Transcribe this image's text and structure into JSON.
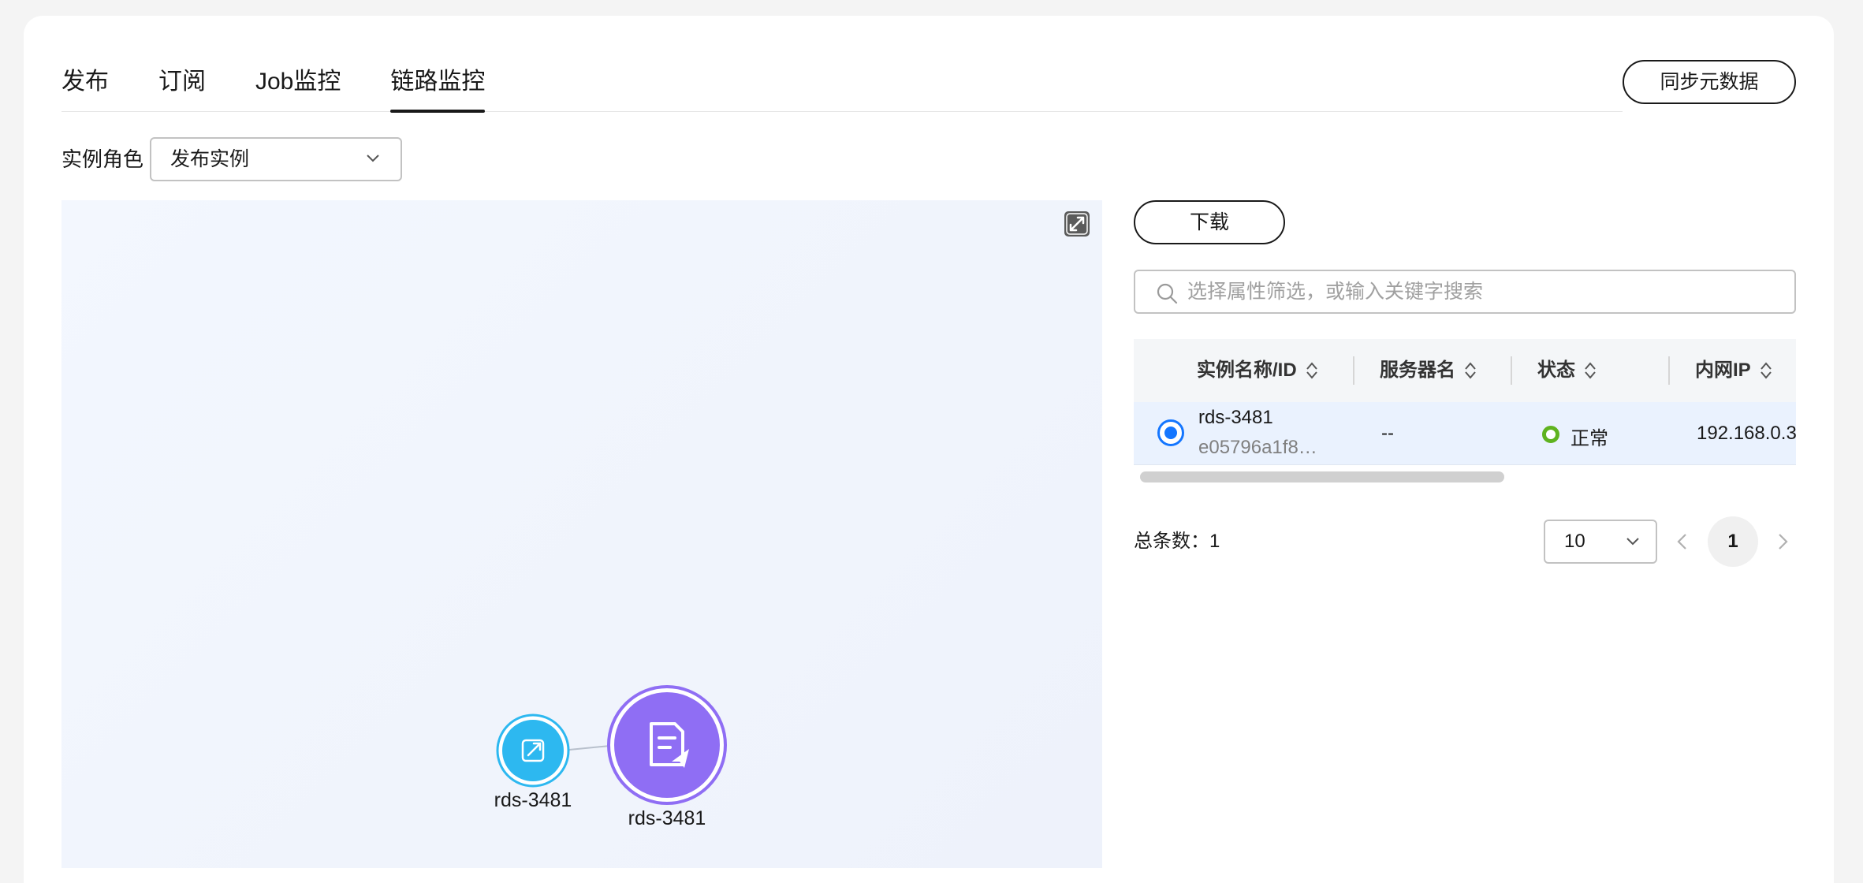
{
  "tabs": [
    {
      "label": "发布"
    },
    {
      "label": "订阅"
    },
    {
      "label": "Job监控"
    },
    {
      "label": "链路监控"
    }
  ],
  "active_tab": "链路监控",
  "sync_button": "同步元数据",
  "role": {
    "label": "实例角色",
    "value": "发布实例"
  },
  "graph": {
    "nodes": [
      {
        "label": "rds-3481",
        "color": "#2db8f0",
        "icon": "external-link-icon"
      },
      {
        "label": "rds-3481",
        "color": "#8f6ef4",
        "icon": "document-send-icon"
      }
    ]
  },
  "download_button": "下载",
  "search": {
    "placeholder": "选择属性筛选，或输入关键字搜索"
  },
  "table": {
    "columns": [
      "实例名称/ID",
      "服务器名",
      "状态",
      "内网IP"
    ],
    "rows": [
      {
        "name": "rds-3481",
        "id": "e05796a1f8…",
        "server": "--",
        "status": "正常",
        "ip": "192.168.0.3"
      }
    ]
  },
  "pagination": {
    "total_label": "总条数：1",
    "page_size": "10",
    "current_page": "1"
  },
  "colors": {
    "accent": "#1476ff",
    "status_ok": "#5fb31f"
  }
}
